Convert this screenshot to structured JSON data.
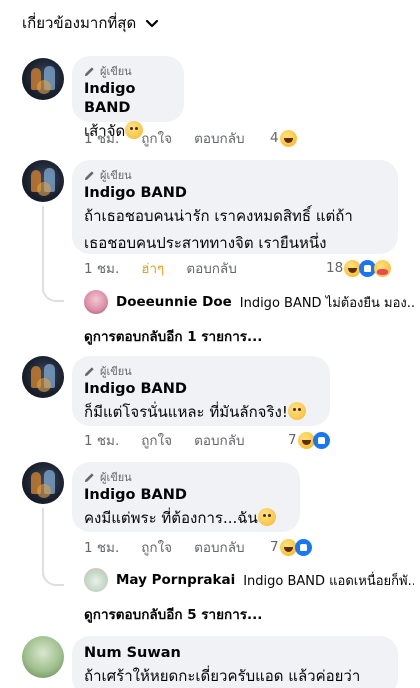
{
  "sort": {
    "label": "เกี่ยวข้องมากที่สุด"
  },
  "comments": [
    {
      "badge": "ผู้เขียน",
      "author": "Indigo BAND",
      "lines": [
        "เส้าจัด"
      ],
      "time": "1 ชม.",
      "like": "ถูกใจ",
      "reply": "ตอบกลับ",
      "reaction_count": "4"
    },
    {
      "badge": "ผู้เขียน",
      "author": "Indigo BAND",
      "lines": [
        "ถ้าเธอชอบคนน่ารัก เราคงหมดสิทธิ์ แต่ถ้า",
        "เธอชอบคนประสาททางจิต เรายืนหนึ่ง"
      ],
      "time": "1 ชม.",
      "like": "ฮ่าๆ",
      "reply": "ตอบกลับ",
      "reaction_count": "18",
      "reply_preview": {
        "name": "Doeeunnie Doe",
        "snippet": "Indigo BAND ไม่ต้องยืน มอง..."
      },
      "more_replies": "ดูการตอบกลับอีก 1 รายการ..."
    },
    {
      "badge": "ผู้เขียน",
      "author": "Indigo BAND",
      "lines": [
        "ก็มีแต่โจรนั่นแหละ ที่มันลักจริง!"
      ],
      "time": "1 ชม.",
      "like": "ถูกใจ",
      "reply": "ตอบกลับ",
      "reaction_count": "7"
    },
    {
      "badge": "ผู้เขียน",
      "author": "Indigo BAND",
      "lines": [
        "คงมีแต่พระ ที่ต้องการ...ฉัน"
      ],
      "time": "1 ชม.",
      "like": "ถูกใจ",
      "reply": "ตอบกลับ",
      "reaction_count": "7",
      "reply_preview": {
        "name": "May Pornprakai",
        "snippet": "Indigo BAND แอดเหนื่อยก็พั..."
      },
      "more_replies": "ดูการตอบกลับอีก 5 รายการ..."
    },
    {
      "author": "Num Suwan",
      "lines": [
        "ถ้าเศร้าให้หยดกะเดี่ยวครับแอด แล้วค่อยว่า"
      ]
    }
  ],
  "colors": {
    "liked_haha": "#e0a322",
    "bubble": "#f0f2f5",
    "meta": "#65676b"
  }
}
